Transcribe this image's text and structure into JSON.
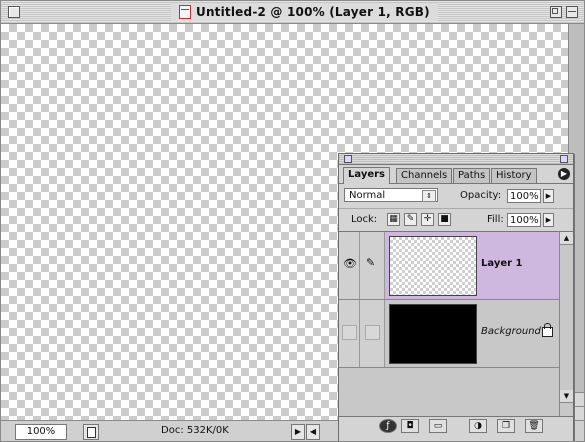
{
  "window": {
    "title": "Untitled-2 @ 100% (Layer 1, RGB)"
  },
  "statusbar": {
    "zoom": "100%",
    "doc_info": "Doc: 532K/0K"
  },
  "layers_palette": {
    "tabs": [
      {
        "label": "Layers",
        "active": true
      },
      {
        "label": "Channels",
        "active": false
      },
      {
        "label": "Paths",
        "active": false
      },
      {
        "label": "History",
        "active": false
      }
    ],
    "blend_mode": "Normal",
    "opacity_label": "Opacity:",
    "opacity_value": "100%",
    "lock_label": "Lock:",
    "fill_label": "Fill:",
    "fill_value": "100%",
    "layers": [
      {
        "name": "Layer 1",
        "selected": true,
        "visible": true,
        "thumbnail": "transparent"
      },
      {
        "name": "Background",
        "selected": false,
        "visible": false,
        "thumbnail": "black",
        "locked": true
      }
    ]
  },
  "colors": {
    "selected_layer_bg": "#cfb8e0",
    "window_bg": "#cfcfcf"
  }
}
